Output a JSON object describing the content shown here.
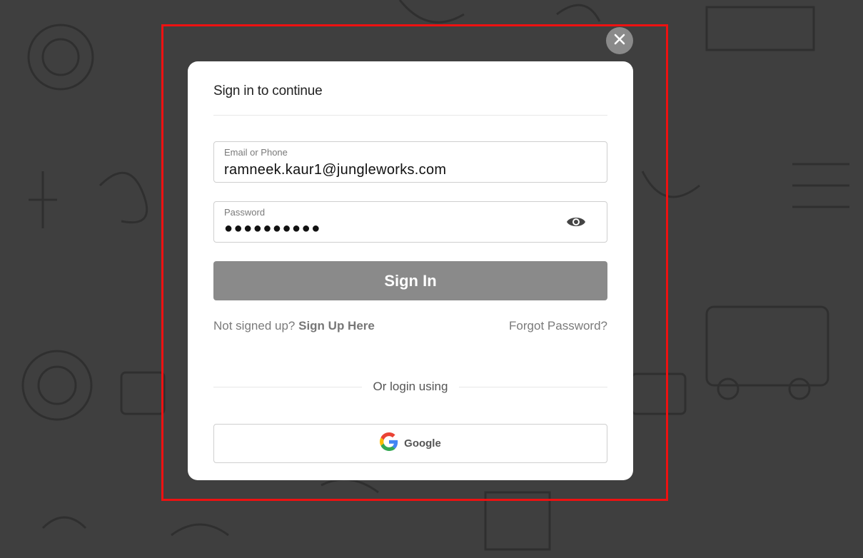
{
  "modal": {
    "title": "Sign in to continue",
    "email": {
      "label": "Email or Phone",
      "value": "ramneek.kaur1@jungleworks.com"
    },
    "password": {
      "label": "Password",
      "masked_value": "●●●●●●●●●●"
    },
    "signin_label": "Sign In",
    "not_signed_up_text": "Not signed up?",
    "signup_link": "Sign Up Here",
    "forgot_link": "Forgot Password?",
    "or_text": "Or login using",
    "google_label": "Google"
  },
  "icons": {
    "close": "close-icon",
    "eye": "eye-icon",
    "google": "google-icon"
  },
  "colors": {
    "overlay": "#3f3f3f",
    "highlight_frame": "#ee1111",
    "button_disabled": "#8a8a8a"
  }
}
